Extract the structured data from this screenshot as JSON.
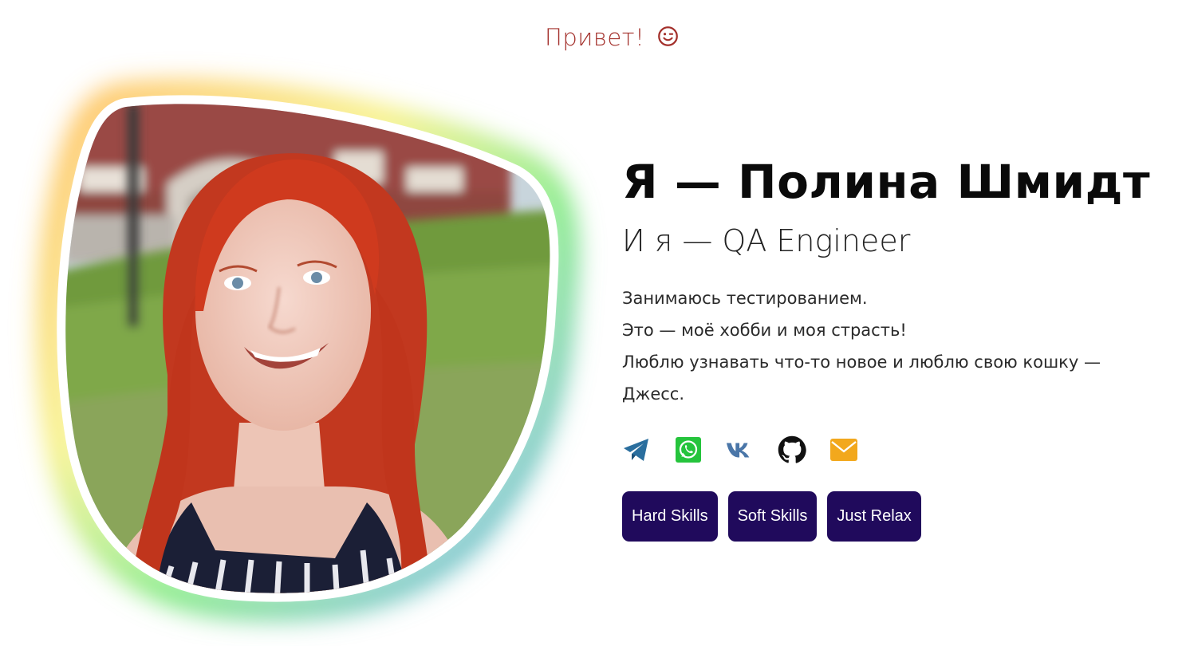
{
  "greeting": {
    "text": "Привет!",
    "icon": "smile-wink-icon"
  },
  "profile": {
    "name": "Я — Полина Шмидт",
    "role": "И я — QA Engineer",
    "about": [
      "Занимаюсь тестированием.",
      "Это — моё хобби и моя страсть!",
      "Люблю узнавать что-то новое и люблю свою кошку — Джесс."
    ],
    "photo_alt": "portrait-photo"
  },
  "socials": [
    {
      "name": "telegram",
      "icon": "telegram-icon",
      "color": "#2a6e9e"
    },
    {
      "name": "whatsapp",
      "icon": "whatsapp-icon",
      "color": "#25c43c"
    },
    {
      "name": "vk",
      "icon": "vk-icon",
      "color": "#4a76a8"
    },
    {
      "name": "github",
      "icon": "github-icon",
      "color": "#111111"
    },
    {
      "name": "email",
      "icon": "mail-icon",
      "color": "#f2a81d"
    }
  ],
  "buttons": {
    "hard_skills": "Hard Skills",
    "soft_skills": "Soft Skills",
    "just_relax": "Just Relax"
  },
  "colors": {
    "greeting": "#a3302b",
    "button_bg": "#200a5c",
    "button_text": "#ffffff"
  }
}
